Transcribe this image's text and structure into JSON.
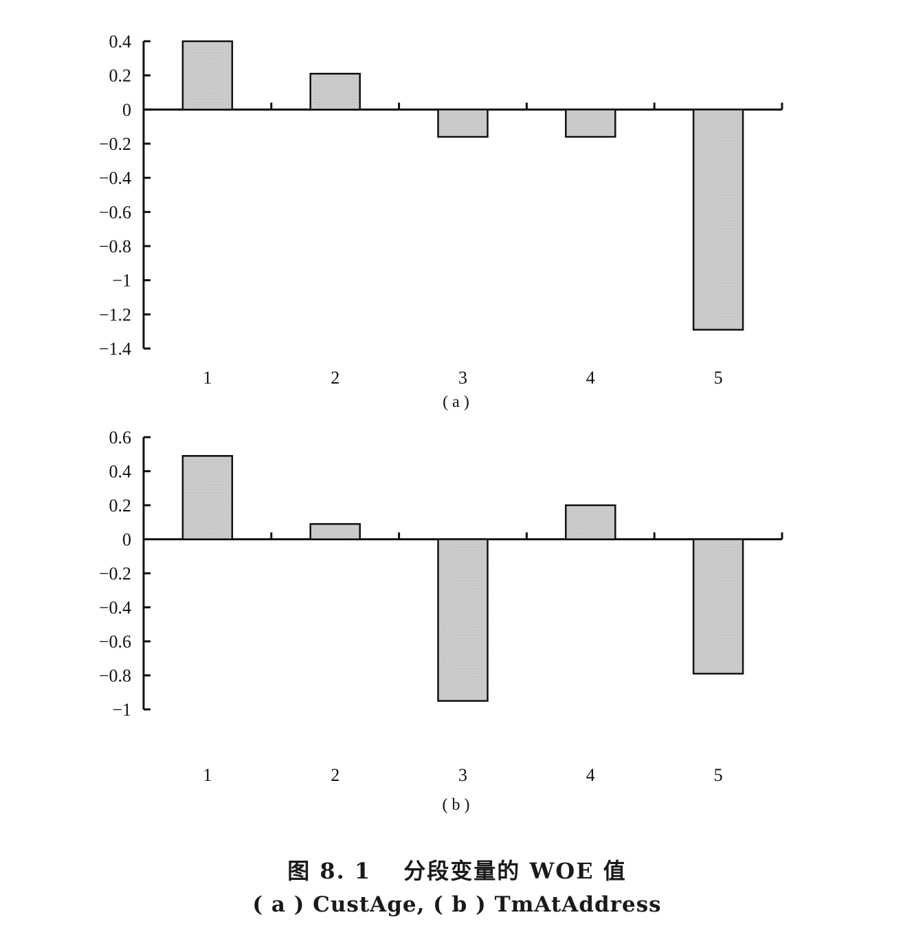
{
  "chart_data": [
    {
      "type": "bar",
      "categories": [
        "1",
        "2",
        "3",
        "4",
        "5"
      ],
      "values": [
        0.4,
        0.21,
        -0.16,
        -0.16,
        -1.29
      ],
      "ylim": [
        -1.4,
        0.4
      ],
      "yticks": [
        "0.4",
        "0.2",
        "0",
        "−0.2",
        "−0.4",
        "−0.6",
        "−0.8",
        "−1",
        "−1.2",
        "−1.4"
      ],
      "ytick_values": [
        0.4,
        0.2,
        0,
        -0.2,
        -0.4,
        -0.6,
        -0.8,
        -1,
        -1.2,
        -1.4
      ],
      "panel_label": "( a )",
      "grid": false,
      "bar_color": "#cfcfcf"
    },
    {
      "type": "bar",
      "categories": [
        "1",
        "2",
        "3",
        "4",
        "5"
      ],
      "values": [
        0.49,
        0.09,
        -0.95,
        0.2,
        -0.79
      ],
      "ylim": [
        -1,
        0.6
      ],
      "yticks": [
        "0.6",
        "0.4",
        "0.2",
        "0",
        "−0.2",
        "−0.4",
        "−0.6",
        "−0.8",
        "−1"
      ],
      "ytick_values": [
        0.6,
        0.4,
        0.2,
        0,
        -0.2,
        -0.4,
        -0.6,
        -0.8,
        -1
      ],
      "panel_label": "( b )",
      "grid": false,
      "bar_color": "#cfcfcf"
    }
  ],
  "caption": {
    "title": "图 8. 1　 分段变量的 WOE 值",
    "subtitle": "( a )  CustAge,  ( b )  TmAtAddress"
  }
}
